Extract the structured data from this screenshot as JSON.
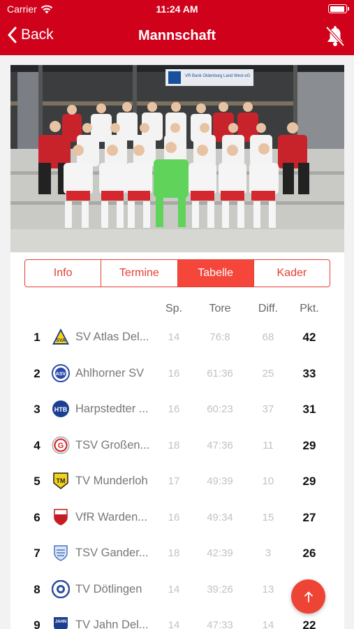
{
  "status": {
    "carrier": "Carrier",
    "time": "11:24 AM"
  },
  "nav": {
    "back_label": "Back",
    "title": "Mannschaft"
  },
  "photo": {
    "sign_text": "VR Bank Oldenburg Land West eG"
  },
  "tabs": [
    {
      "label": "Info",
      "active": false
    },
    {
      "label": "Termine",
      "active": false
    },
    {
      "label": "Tabelle",
      "active": true
    },
    {
      "label": "Kader",
      "active": false
    }
  ],
  "table": {
    "headers": {
      "games": "Sp.",
      "goals": "Tore",
      "diff": "Diff.",
      "points": "Pkt."
    },
    "rows": [
      {
        "rank": "1",
        "team": "SV Atlas Del...",
        "games": "14",
        "goals": "76:8",
        "diff": "68",
        "points": "42"
      },
      {
        "rank": "2",
        "team": "Ahlhorner SV",
        "games": "16",
        "goals": "61:36",
        "diff": "25",
        "points": "33"
      },
      {
        "rank": "3",
        "team": "Harpstedter ...",
        "games": "16",
        "goals": "60:23",
        "diff": "37",
        "points": "31"
      },
      {
        "rank": "4",
        "team": "TSV Großen...",
        "games": "18",
        "goals": "47:36",
        "diff": "11",
        "points": "29"
      },
      {
        "rank": "5",
        "team": "TV Munderloh",
        "games": "17",
        "goals": "49:39",
        "diff": "10",
        "points": "29"
      },
      {
        "rank": "6",
        "team": "VfR Warden...",
        "games": "16",
        "goals": "49:34",
        "diff": "15",
        "points": "27"
      },
      {
        "rank": "7",
        "team": "TSV Gander...",
        "games": "18",
        "goals": "42:39",
        "diff": "3",
        "points": "26"
      },
      {
        "rank": "8",
        "team": "TV Dötlingen",
        "games": "14",
        "goals": "39:26",
        "diff": "13",
        "points": ""
      },
      {
        "rank": "9",
        "team": "TV Jahn Del...",
        "games": "14",
        "goals": "47:33",
        "diff": "14",
        "points": "22"
      }
    ]
  },
  "colors": {
    "brand": "#d0021b",
    "accent": "#f4463a"
  }
}
